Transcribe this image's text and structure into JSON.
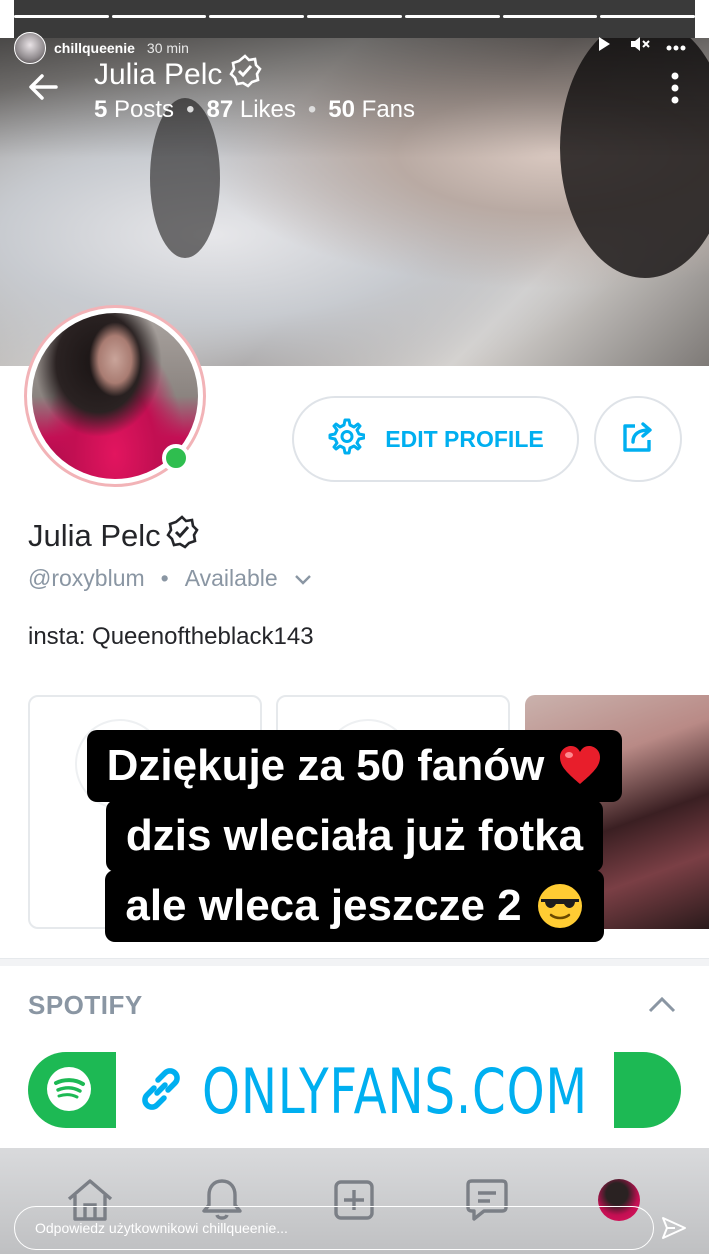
{
  "story": {
    "username": "chillqueenie",
    "time_ago": "30 min",
    "progress_segments": 7,
    "segments_done": 7,
    "reply_placeholder": "Odpowiedz użytkownikowi chillqueenie..."
  },
  "header": {
    "name": "Julia Pelc",
    "posts_count": "5",
    "posts_label": "Posts",
    "likes_count": "87",
    "likes_label": "Likes",
    "fans_count": "50",
    "fans_label": "Fans"
  },
  "profile": {
    "name": "Julia Pelc",
    "handle": "@roxyblum",
    "status": "Available",
    "bio": "insta: Queenoftheblack143",
    "edit_label": "EDIT PROFILE"
  },
  "caption": {
    "line1": "Dziękuje za 50 fanów",
    "line2": "dzis wleciała już fotka",
    "line3": "ale wleca jeszcze 2"
  },
  "spotify": {
    "section_title": "SPOTIFY",
    "link_text": "ONLYFANS.COM"
  },
  "colors": {
    "accent": "#00aff0",
    "spotify_green": "#1db954",
    "online_green": "#2fbe4f"
  }
}
